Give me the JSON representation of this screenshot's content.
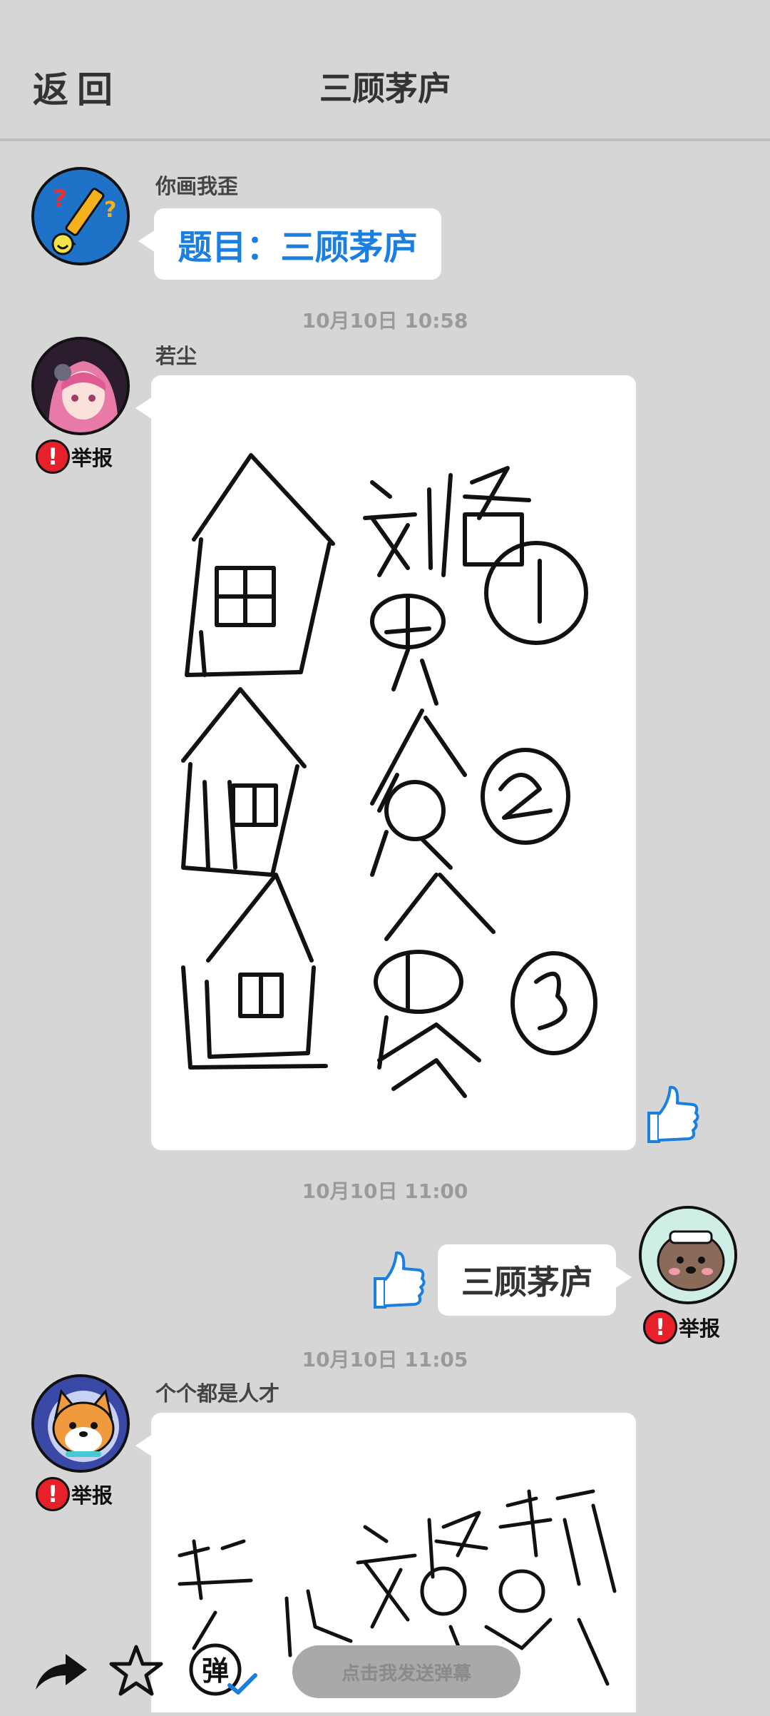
{
  "header": {
    "back_label": "返回",
    "title": "三顾茅庐"
  },
  "messages": [
    {
      "sender": "你画我歪",
      "text": "题目：三顾茅庐",
      "text_color": "#1a7fe0",
      "avatar_icon": "pencil-question-avatar"
    },
    {
      "timestamp": "10月10日  10:58",
      "sender": "若尘",
      "avatar_icon": "anime-girl-avatar",
      "report_label": "举报",
      "drawing_words": [
        "刘备",
        "①",
        "男",
        "人",
        "②",
        "贪",
        "人",
        "男",
        "③"
      ],
      "like_icon": "thumbs-up-icon"
    },
    {
      "timestamp": "10月10日  11:00",
      "text": "三顾茅庐",
      "avatar_icon": "poodle-dog-avatar",
      "report_label": "举报",
      "like_icon": "thumbs-up-icon"
    },
    {
      "timestamp": "10月10日  11:05",
      "sender": "个个都是人才",
      "avatar_icon": "shiba-dog-avatar",
      "report_label": "举报"
    }
  ],
  "bottom": {
    "danmaku_placeholder": "点击我发送弹幕",
    "danmaku_icon_label": "弹"
  },
  "colors": {
    "background": "#d6d6d6",
    "accent_blue": "#1a7fe0",
    "report_red": "#e8202a"
  }
}
